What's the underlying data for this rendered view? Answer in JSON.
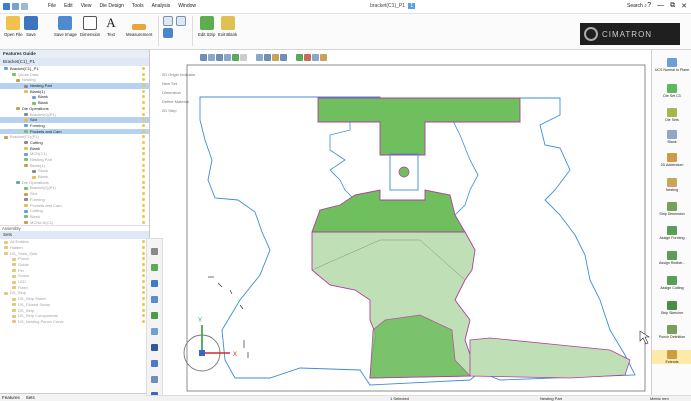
{
  "window": {
    "menu": [
      "File",
      "Edit",
      "View",
      "Die Design",
      "Tools",
      "Analysis",
      "Window"
    ],
    "doc_title": "bracket(C1)_P1",
    "doc_tag": "1",
    "search_label": "Search",
    "controls": [
      "?",
      "—",
      "⧉",
      "✕"
    ]
  },
  "ribbon": {
    "open_file": "Open File",
    "save": "Save",
    "save_image": "Save Image",
    "dimension": "Dimension",
    "text": "Text",
    "measurement": "Measurement",
    "edit_strip": "Edit Strip",
    "exit_blank": "Exit Blank",
    "logo": "CIMATRON"
  },
  "left_panel": {
    "features_title": "Features Guide",
    "tree_header": "Bracket(C1)_P1",
    "tree": [
      {
        "label": "Bracket(C1)_P1",
        "indent": 1,
        "state": "normal"
      },
      {
        "label": "Quote Data",
        "indent": 3,
        "state": "dim"
      },
      {
        "label": "Nesting",
        "indent": 4,
        "state": "dim"
      },
      {
        "label": "Nesting Part",
        "indent": 6,
        "state": "sel"
      },
      {
        "label": "Blank(1)",
        "indent": 6,
        "state": "normal"
      },
      {
        "label": "Blank",
        "indent": 8,
        "state": "normal"
      },
      {
        "label": "Blank",
        "indent": 8,
        "state": "normal"
      },
      {
        "label": "Die Operations",
        "indent": 4,
        "state": "normal"
      },
      {
        "label": "Bracket(1)(P1)",
        "indent": 6,
        "state": "dim"
      },
      {
        "label": "Slot",
        "indent": 6,
        "state": "sel"
      },
      {
        "label": "Forming",
        "indent": 6,
        "state": "normal"
      },
      {
        "label": "Pockets and Cam",
        "indent": 6,
        "state": "sel"
      },
      {
        "label": "Bracket(C1)(P1)",
        "indent": 1,
        "state": "dim"
      },
      {
        "label": "Cutting",
        "indent": 6,
        "state": "normal"
      },
      {
        "label": "Blank",
        "indent": 6,
        "state": "normal"
      },
      {
        "label": "MCN(C1)",
        "indent": 6,
        "state": "dim"
      },
      {
        "label": "Nesting Part",
        "indent": 6,
        "state": "dim"
      },
      {
        "label": "Blank(1)",
        "indent": 6,
        "state": "dim"
      },
      {
        "label": "Stock",
        "indent": 8,
        "state": "dim"
      },
      {
        "label": "Blank",
        "indent": 8,
        "state": "dim"
      },
      {
        "label": "Die Operations",
        "indent": 4,
        "state": "dim"
      },
      {
        "label": "Bracket(1)(P1)",
        "indent": 6,
        "state": "dim"
      },
      {
        "label": "Slot",
        "indent": 6,
        "state": "dim"
      },
      {
        "label": "Forming",
        "indent": 6,
        "state": "dim"
      },
      {
        "label": "Pockets and Cam",
        "indent": 6,
        "state": "dim"
      },
      {
        "label": "Cutting",
        "indent": 6,
        "state": "dim"
      },
      {
        "label": "Blank",
        "indent": 6,
        "state": "dim"
      },
      {
        "label": "MCN#-N(C1)",
        "indent": 6,
        "state": "dim"
      }
    ],
    "section_features": "Features",
    "section_assembly": "Assembly",
    "sets_header": "Sets",
    "sets": [
      {
        "label": "All Entities",
        "indent": 1
      },
      {
        "label": "Hidden",
        "indent": 1
      },
      {
        "label": "DS_Tools_Sets",
        "indent": 1
      },
      {
        "label": "Punch",
        "indent": 3
      },
      {
        "label": "Guide",
        "indent": 3
      },
      {
        "label": "Pin",
        "indent": 3
      },
      {
        "label": "Screw",
        "indent": 3
      },
      {
        "label": "LED",
        "indent": 3
      },
      {
        "label": "Fixed",
        "indent": 3
      },
      {
        "label": "DS_Strip",
        "indent": 1
      },
      {
        "label": "DS_Strip Sheet",
        "indent": 3
      },
      {
        "label": "DS_Closed Scrap",
        "indent": 3
      },
      {
        "label": "DS_Strip",
        "indent": 3
      },
      {
        "label": "DS_Strip Components",
        "indent": 3
      },
      {
        "label": "DS_Nesting Punch Curve",
        "indent": 3
      }
    ],
    "bottom_tabs": [
      "Features",
      "Sets"
    ]
  },
  "view": {
    "info_lines": [
      "2D Origin Indicator",
      "New Set",
      "Dimension",
      "Define Material",
      "2D Strip"
    ],
    "axis_y": "Y",
    "axis_x": "X"
  },
  "right_panel": {
    "items": [
      {
        "label": "UCS Normal to Plane",
        "icon_color": "#6c9fd6"
      },
      {
        "label": "Die Set C3",
        "icon_color": "#5cb85c"
      },
      {
        "label": "Die Sets",
        "icon_color": "#a3b84e"
      },
      {
        "label": "Blank",
        "icon_color": "#8fa8c8"
      },
      {
        "label": "2D Addendum",
        "icon_color": "#d09a4a"
      },
      {
        "label": "Nesting",
        "icon_color": "#c8a65a"
      },
      {
        "label": "Strip Dimension",
        "icon_color": "#7a9e5c"
      },
      {
        "label": "Assign Forming",
        "icon_color": "#5b9c5b"
      },
      {
        "label": "Assign Redistr...",
        "icon_color": "#5b9c5b"
      },
      {
        "label": "Assign Cutting",
        "icon_color": "#5b9c5b"
      },
      {
        "label": "Strip Sketcher",
        "icon_color": "#4a8c4a"
      },
      {
        "label": "Punch Definition",
        "icon_color": "#7a9e5c"
      },
      {
        "label": "Extends",
        "icon_color": "#c8a040"
      }
    ],
    "active_index": 12
  },
  "status": {
    "left": "1 Selected",
    "mid": "Nesting Part",
    "right": "Metric mm"
  },
  "colors": {
    "green_fill": "#6fbf5f",
    "green_light": "#bfe0b6",
    "outline_blue": "#3a8ed8",
    "outline_magenta": "#b23d9e",
    "selected_row": "#b6d2f0"
  }
}
